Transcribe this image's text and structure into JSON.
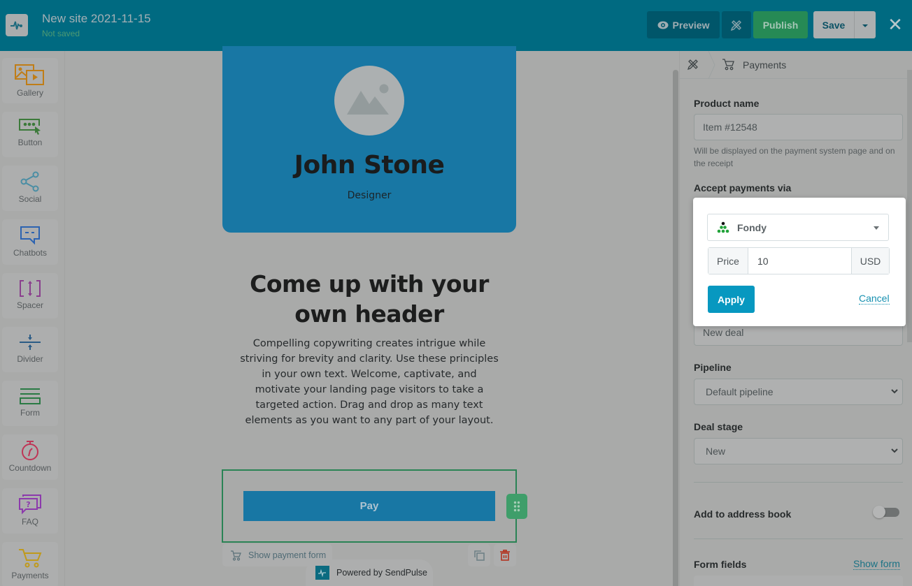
{
  "topbar": {
    "site_title": "New site 2021-11-15",
    "save_status": "Not saved",
    "preview_label": "Preview",
    "publish_label": "Publish",
    "save_label": "Save",
    "close_glyph": "✕"
  },
  "sidebar": {
    "items": [
      {
        "label": "Gallery",
        "icon": "gallery-icon",
        "color": "#c07d17"
      },
      {
        "label": "Button",
        "icon": "button-icon",
        "color": "#3c7a3a"
      },
      {
        "label": "Social",
        "icon": "share-icon",
        "color": "#4b8ea4"
      },
      {
        "label": "Chatbots",
        "icon": "chat-icon",
        "color": "#2c63b1"
      },
      {
        "label": "Spacer",
        "icon": "spacer-icon",
        "color": "#8a3f8d"
      },
      {
        "label": "Divider",
        "icon": "divider-icon",
        "color": "#2a5b85"
      },
      {
        "label": "Form",
        "icon": "form-icon",
        "color": "#2a7a44"
      },
      {
        "label": "Countdown",
        "icon": "stopwatch-icon",
        "color": "#bf3556"
      },
      {
        "label": "FAQ",
        "icon": "faq-icon",
        "color": "#8c3aac"
      },
      {
        "label": "Payments",
        "icon": "cart-icon",
        "color": "#c09a1c"
      }
    ]
  },
  "canvas": {
    "hero_name": "John Stone",
    "hero_role": "Designer",
    "headline": "Come up with your own header",
    "body_copy": "Compelling copywriting creates intrigue while striving for brevity and clarity. Use these principles in your own text. Welcome, captivate, and motivate your landing page visitors to take a targeted action. Drag and drop as many text elements as you want to any part of your layout.",
    "pay_button_label": "Pay",
    "show_payment_form_label": "Show payment form",
    "powered_by": "Powered by SendPulse"
  },
  "panel": {
    "breadcrumb_label": "Payments",
    "product_name_label": "Product name",
    "product_name_value": "Item #12548",
    "product_name_hint": "Will be displayed on the payment system page and on the receipt",
    "accept_payments_label": "Accept payments via",
    "deal_name_value": "New deal",
    "pipeline_label": "Pipeline",
    "pipeline_value": "Default pipeline",
    "deal_stage_label": "Deal stage",
    "deal_stage_value": "New",
    "add_to_address_book_label": "Add to address book",
    "add_to_address_book_on": false,
    "form_fields_label": "Form fields",
    "show_form_label": "Show form"
  },
  "popup": {
    "provider": "Fondy",
    "price_label": "Price",
    "price_value": "10",
    "currency": "USD",
    "apply_label": "Apply",
    "cancel_label": "Cancel"
  },
  "colors": {
    "topbar": "#006a81",
    "publish": "#268a55",
    "apply": "#0798c0",
    "hero": "#1877a4",
    "selection": "#2a8355"
  }
}
